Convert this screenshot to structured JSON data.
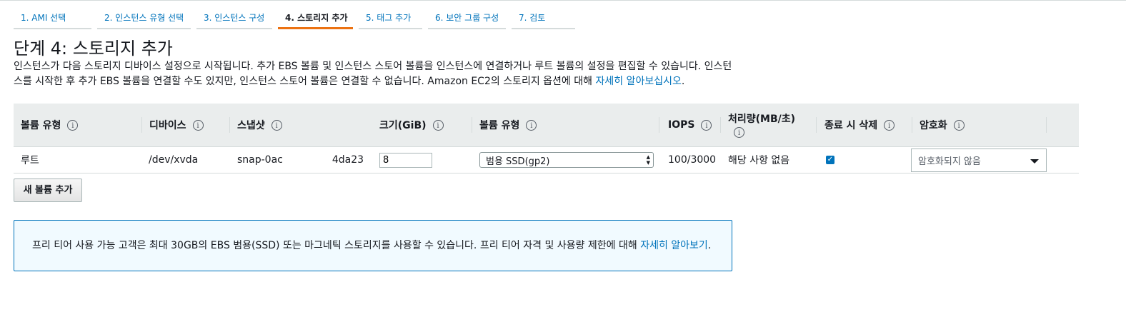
{
  "wizard": {
    "tabs": [
      {
        "label": "1. AMI 선택"
      },
      {
        "label": "2. 인스턴스 유형 선택"
      },
      {
        "label": "3. 인스턴스 구성"
      },
      {
        "label": "4. 스토리지 추가"
      },
      {
        "label": "5. 태그 추가"
      },
      {
        "label": "6. 보안 그룹 구성"
      },
      {
        "label": "7. 검토"
      }
    ],
    "active_tab": "4. 스토리지 추가"
  },
  "page": {
    "title": "단계 4: 스토리지 추가",
    "description": "인스턴스가 다음 스토리지 디바이스 설정으로 시작됩니다. 추가 EBS 볼륨 및 인스턴스 스토어 볼륨을 인스턴스에 연결하거나 루트 볼륨의 설정을 편집할 수 있습니다. 인스턴스를 시작한 후 추가 EBS 볼륨을 연결할 수도 있지만, 인스턴스 스토어 볼륨은 연결할 수 없습니다. Amazon EC2의 스토리지 옵션에 대해",
    "learn_more": "자세히 알아보십시오",
    "period": "."
  },
  "table": {
    "headers": {
      "volume_type": "볼륨 유형",
      "device": "디바이스",
      "snapshot": "스냅샷",
      "size": "크기(GiB)",
      "ebs_type": "볼륨 유형",
      "iops": "IOPS",
      "throughput": "처리량(MB/초)",
      "delete_on_termination": "종료 시 삭제",
      "encryption": "암호화"
    },
    "info_icon": "i",
    "row": {
      "volume_type": "루트",
      "device": "/dev/xvda",
      "snapshot_left": "snap-0ac",
      "snapshot_right": "4da23",
      "size": "8",
      "ebs_type": "범용 SSD(gp2)",
      "iops": "100/3000",
      "throughput": "해당 사항 없음",
      "delete_on_termination": true,
      "encryption": "암호화되지 않음"
    }
  },
  "buttons": {
    "add_volume": "새 볼륨 추가"
  },
  "notice": {
    "text": "프리 티어 사용 가능 고객은 최대 30GB의 EBS 범용(SSD) 또는 마그네틱 스토리지를 사용할 수 있습니다. 프리 티어 자격 및 사용량 제한에 대해",
    "link": "자세히 알아보기",
    "period": "."
  },
  "colors": {
    "accent": "#ec7211",
    "link": "#0073bb",
    "info_bg": "#f1faff"
  }
}
